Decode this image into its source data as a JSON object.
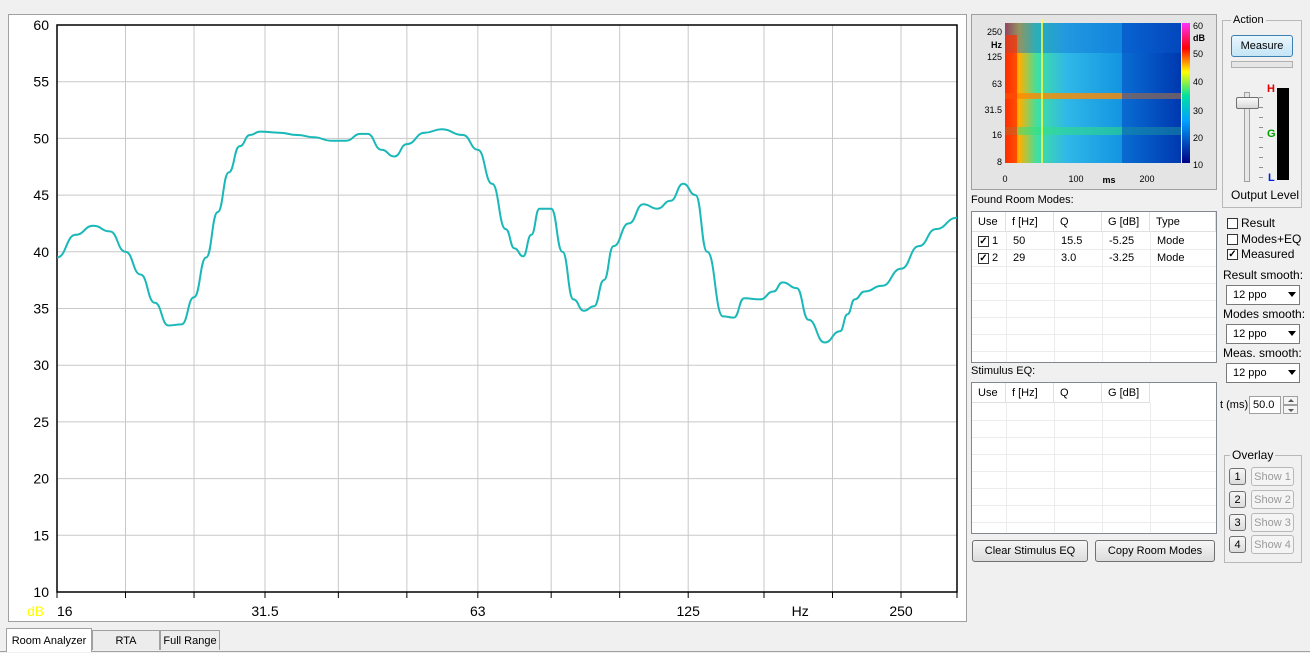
{
  "chart_data": {
    "type": "line",
    "x_scale": "log",
    "xlim": [
      16,
      300
    ],
    "ylim": [
      10,
      60
    ],
    "y_ticks": [
      10,
      15,
      20,
      25,
      30,
      35,
      40,
      45,
      50,
      55,
      60
    ],
    "x_ticks": [
      16,
      31.5,
      63,
      125,
      250
    ],
    "x_tick_labels": [
      "16",
      "31.5",
      "63",
      "125",
      "250"
    ],
    "xlabel": "Hz",
    "ylabel": "dB",
    "grid": true,
    "line_color": "#1ab8b8",
    "series": [
      {
        "x": [
          16,
          17,
          18,
          19,
          20,
          21,
          22,
          23,
          24,
          25,
          26,
          27,
          28,
          29,
          30,
          31,
          33,
          35,
          37,
          39,
          41,
          43,
          44,
          46,
          48,
          50,
          53,
          56,
          60,
          63,
          66,
          69,
          71,
          73,
          75,
          77,
          80,
          83,
          86,
          89,
          92,
          95,
          98,
          103,
          108,
          113,
          118,
          123,
          128,
          133,
          140,
          145,
          150,
          158,
          165,
          170,
          178,
          185,
          195,
          205,
          210,
          215,
          222,
          235,
          250,
          265,
          280,
          300
        ],
        "values": [
          39.5,
          41.5,
          42.3,
          41.8,
          40,
          38,
          35.5,
          33.5,
          33.6,
          36,
          39.5,
          43.5,
          47,
          49.3,
          50.3,
          50.6,
          50.5,
          50.3,
          50.1,
          49.8,
          49.8,
          50.4,
          50.4,
          49,
          48.4,
          49.5,
          50.5,
          50.8,
          50.3,
          49,
          46,
          42,
          40.3,
          39.6,
          41.5,
          43.8,
          43.8,
          40,
          35.8,
          34.8,
          35.2,
          37.5,
          40.5,
          42.5,
          44.2,
          43.8,
          44.5,
          46,
          45,
          40,
          34.3,
          34.2,
          35.9,
          35.8,
          36.5,
          37.3,
          36.8,
          34,
          32,
          33,
          34.5,
          35.8,
          36.5,
          37,
          38.5,
          40.5,
          42,
          43
        ]
      }
    ]
  },
  "spectrogram": {
    "y_tick_labels": [
      "250",
      "125",
      "63",
      "31.5",
      "16",
      "8"
    ],
    "y_unit": "Hz",
    "x_tick_labels": [
      "0",
      "100",
      "200"
    ],
    "x_unit": "ms",
    "scale_labels": [
      "60",
      "50",
      "40",
      "30",
      "20",
      "10"
    ],
    "scale_unit": "dB",
    "cursor_time_ms": 50
  },
  "action": {
    "title": "Action",
    "measure_label": "Measure",
    "level_high": "H",
    "level_mid": "G",
    "level_low": "L",
    "output_level_label": "Output Level"
  },
  "room_modes": {
    "title": "Found Room Modes:",
    "columns": [
      "Use",
      "f [Hz]",
      "Q",
      "G [dB]",
      "Type"
    ],
    "rows": [
      {
        "index": "1",
        "f": "50",
        "q": "15.5",
        "g": "-5.25",
        "type": "Mode",
        "checked": true
      },
      {
        "index": "2",
        "f": "29",
        "q": "3.0",
        "g": "-3.25",
        "type": "Mode",
        "checked": true
      }
    ]
  },
  "stimulus_eq": {
    "title": "Stimulus EQ:",
    "columns": [
      "Use",
      "f [Hz]",
      "Q",
      "G [dB]"
    ]
  },
  "display": {
    "result_label": "Result",
    "result_checked": false,
    "modes_eq_label": "Modes+EQ",
    "modes_eq_checked": false,
    "measured_label": "Measured",
    "measured_checked": true,
    "result_smooth_label": "Result smooth:",
    "result_smooth_value": "12 ppo",
    "modes_smooth_label": "Modes smooth:",
    "modes_smooth_value": "12 ppo",
    "meas_smooth_label": "Meas. smooth:",
    "meas_smooth_value": "12 ppo",
    "t_label": "t (ms)",
    "t_value": "50.0"
  },
  "buttons": {
    "clear_stimulus_eq": "Clear Stimulus EQ",
    "copy_room_modes": "Copy Room Modes"
  },
  "overlay": {
    "title": "Overlay",
    "items": [
      {
        "num": "1",
        "show": "Show 1"
      },
      {
        "num": "2",
        "show": "Show 2"
      },
      {
        "num": "3",
        "show": "Show 3"
      },
      {
        "num": "4",
        "show": "Show 4"
      }
    ]
  },
  "tabs": [
    "Room Analyzer",
    "RTA",
    "Full Range"
  ]
}
